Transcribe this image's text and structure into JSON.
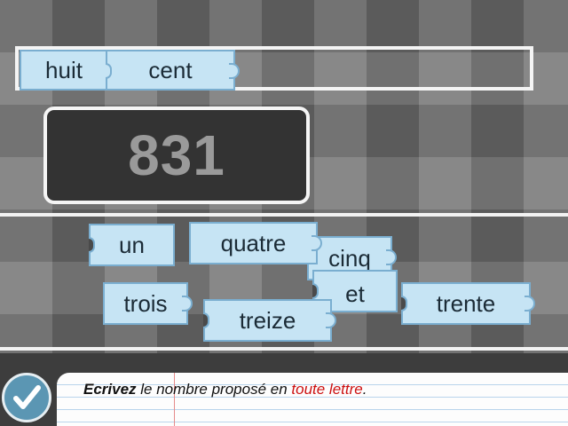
{
  "number": "831",
  "answer_tiles": [
    "huit",
    "cent"
  ],
  "choice_tiles": {
    "un": "un",
    "quatre": "quatre",
    "cinq": "cinq",
    "trois": "trois",
    "et": "et",
    "trente": "trente",
    "treize": "treize"
  },
  "instruction": {
    "verb": "Ecrivez",
    "middle": " le nombre proposé en ",
    "highlight": "toute lettre",
    "end": "."
  },
  "colors": {
    "tile_fill": "#c6e4f4",
    "tile_border": "#7aaed0",
    "highlight_text": "#cc1010",
    "check_button": "#5b96b3"
  },
  "icons": {
    "check": "check-icon"
  }
}
